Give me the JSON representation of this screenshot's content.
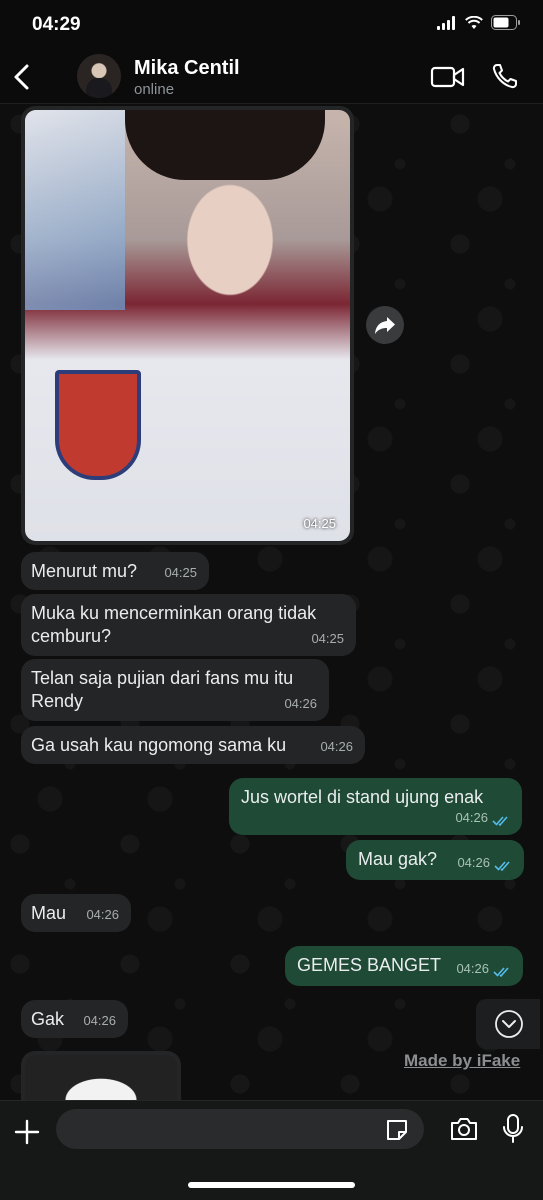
{
  "status_bar": {
    "time": "04:29"
  },
  "header": {
    "contact_name": "Mika Centil",
    "contact_status": "online"
  },
  "photo_message": {
    "time": "04:25"
  },
  "messages": [
    {
      "text": "Menurut mu?",
      "time": "04:25"
    },
    {
      "text": "Muka ku mencerminkan orang tidak cemburu?",
      "time": "04:25"
    },
    {
      "text": "Telan saja pujian dari fans mu itu Rendy",
      "time": "04:26"
    },
    {
      "text": "Ga usah kau ngomong sama ku",
      "time": "04:26"
    },
    {
      "text": "Jus wortel di stand ujung enak",
      "time": "04:26"
    },
    {
      "text": "Mau gak?",
      "time": "04:26"
    },
    {
      "text": "Mau",
      "time": "04:26"
    },
    {
      "text": "GEMES BANGET",
      "time": "04:26"
    },
    {
      "text": "Gak",
      "time": "04:26"
    }
  ],
  "watermark": "Made by iFake",
  "input": {
    "placeholder": ""
  },
  "colors": {
    "incoming_bubble": "#242526",
    "outgoing_bubble": "#1f4a36",
    "read_ticks": "#53bdeb"
  }
}
